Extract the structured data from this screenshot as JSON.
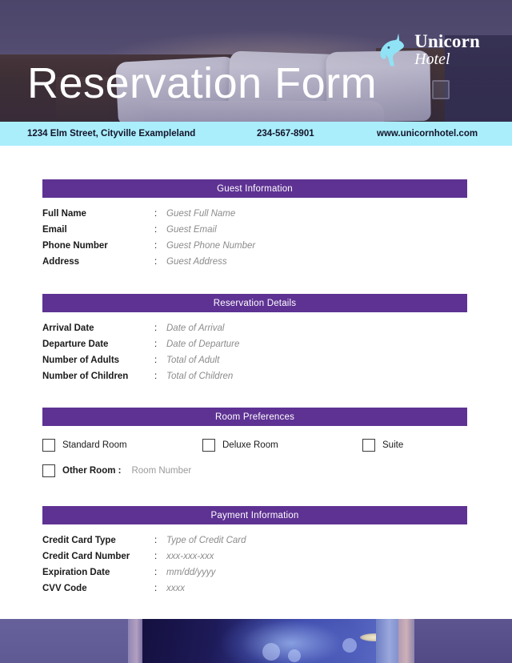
{
  "header": {
    "title": "Reservation Form",
    "logo": {
      "mark": "unicorn-head-icon",
      "name": "Unicorn",
      "subtitle": "Hotel"
    }
  },
  "contact_bar": {
    "address": "1234 Elm Street, Cityville Exampleland",
    "phone": "234-567-8901",
    "website": "www.unicornhotel.com"
  },
  "sections": [
    {
      "title": "Guest Information",
      "rows": [
        {
          "label": "Full Name",
          "separator": ":",
          "placeholder": "Guest Full Name"
        },
        {
          "label": "Email",
          "separator": ":",
          "placeholder": "Guest Email"
        },
        {
          "label": "Phone Number",
          "separator": ":",
          "placeholder": "Guest Phone Number"
        },
        {
          "label": "Address",
          "separator": ":",
          "placeholder": "Guest Address"
        }
      ]
    },
    {
      "title": "Reservation Details",
      "rows": [
        {
          "label": "Arrival Date",
          "separator": ":",
          "placeholder": "Date of Arrival"
        },
        {
          "label": "Departure Date",
          "separator": ":",
          "placeholder": "Date of Departure"
        },
        {
          "label": "Number of Adults",
          "separator": ":",
          "placeholder": "Total of Adult"
        },
        {
          "label": "Number of Children",
          "separator": ":",
          "placeholder": "Total of Children"
        }
      ]
    },
    {
      "title": "Room Preferences",
      "checkboxes": [
        {
          "label": "Standard Room",
          "checked": false
        },
        {
          "label": "Deluxe Room",
          "checked": false
        },
        {
          "label": "Suite",
          "checked": false
        },
        {
          "label": "Other Room :",
          "placeholder": "Room Number",
          "checked": false
        }
      ]
    },
    {
      "title": "Payment Information",
      "rows": [
        {
          "label": "Credit Card Type",
          "separator": ":",
          "placeholder": "Type of Credit Card"
        },
        {
          "label": "Credit Card Number",
          "separator": ":",
          "placeholder": "xxx-xxx-xxx"
        },
        {
          "label": "Expiration Date",
          "separator": ":",
          "placeholder": "mm/dd/yyyy"
        },
        {
          "label": "CVV Code",
          "separator": ":",
          "placeholder": "xxxx"
        }
      ]
    }
  ],
  "colors": {
    "section_purple": "#5e3293",
    "contact_cyan": "#aaeefb",
    "logo_cyan": "#8fe3f5",
    "page_background": "#ffffff",
    "label_text": "#1a1a1a",
    "placeholder_text": "#8b8b8b"
  },
  "footer": {
    "image_alt": "hotel-interior-photo"
  }
}
